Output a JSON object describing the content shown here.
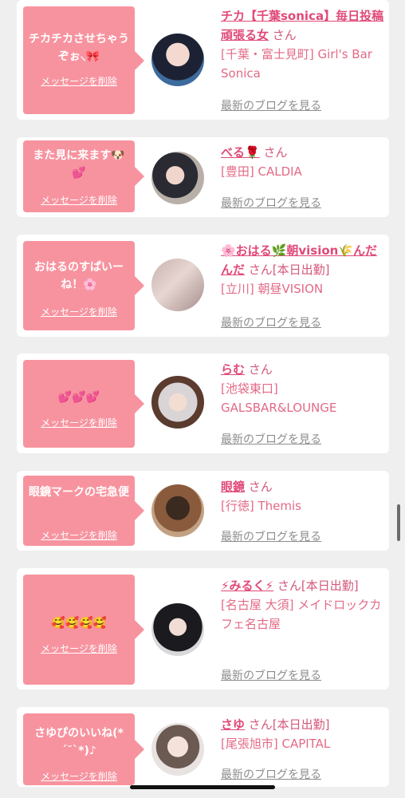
{
  "delete_label": "メッセージを削除",
  "blog_label": "最新のブログを見る",
  "cards": [
    {
      "message": "チカチカさせちゃうぞぉ⸜🎀",
      "name": "チカ【千葉sonica】毎日投稿頑張る女",
      "san": "さん",
      "shop": "[千葉・富士見町] Girl's Bar Sonica"
    },
    {
      "message": "また見に来ます🐶💕",
      "name": "べる🌹",
      "san": "さん",
      "shop": "[豊田] CALDIA"
    },
    {
      "message": "おはるのすぱいーね！🌸",
      "name": "🌸おはる🌿朝vision🌾んだんだ",
      "san": "さん[本日出勤]",
      "shop": "[立川] 朝昼VISION"
    },
    {
      "message": "💕💕💕",
      "name": "らむ",
      "san": "さん",
      "shop": "[池袋東口] GALSBAR&LOUNGE"
    },
    {
      "message": "眼鏡マークの宅急便",
      "name": "眼鏡",
      "san": "さん",
      "shop": "[行徳] Themis"
    },
    {
      "message": "🥰🥰🥰🥰",
      "name": "⚡みるく⚡",
      "san": "さん[本日出勤]",
      "shop": "[名古屋 大須] メイドロックカフェ名古屋"
    },
    {
      "message": "さゆぴのいいね(*´˘`*)♪",
      "name": "さゆ",
      "san": "さん[本日出勤]",
      "shop": "[尾張旭市] CAPITAL"
    }
  ]
}
